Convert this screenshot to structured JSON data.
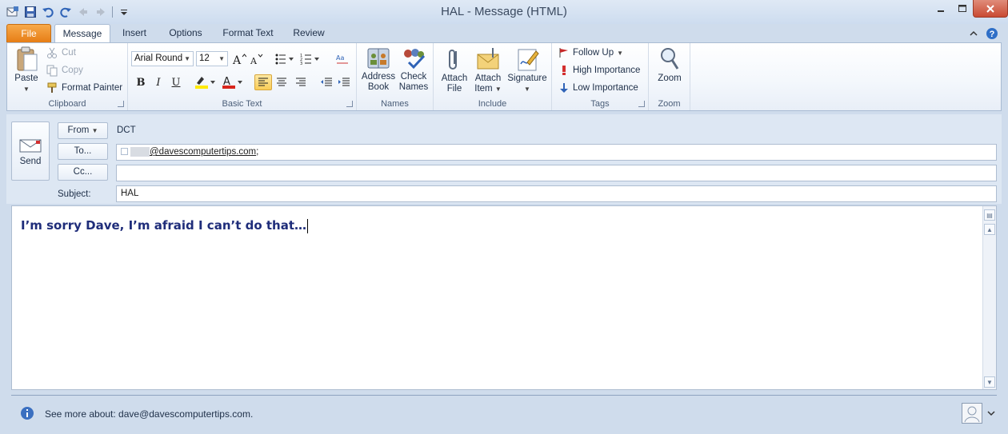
{
  "window": {
    "title": "HAL  -  Message (HTML)"
  },
  "ribbon_tabs": [
    {
      "label": "File"
    },
    {
      "label": "Message"
    },
    {
      "label": "Insert"
    },
    {
      "label": "Options"
    },
    {
      "label": "Format Text"
    },
    {
      "label": "Review"
    }
  ],
  "clipboard": {
    "paste": "Paste",
    "cut": "Cut",
    "copy": "Copy",
    "format_painter": "Format Painter",
    "label": "Clipboard"
  },
  "basic_text": {
    "font": "Arial Round",
    "size": "12",
    "bold": "B",
    "italic": "I",
    "underline": "U",
    "label": "Basic Text"
  },
  "names": {
    "address_line1": "Address",
    "address_line2": "Book",
    "check_line1": "Check",
    "check_line2": "Names",
    "label": "Names"
  },
  "include": {
    "attach_file_1": "Attach",
    "attach_file_2": "File",
    "attach_item_1": "Attach",
    "attach_item_2": "Item",
    "signature": "Signature",
    "label": "Include"
  },
  "tags": {
    "follow_up": "Follow Up",
    "high": "High Importance",
    "low": "Low Importance",
    "label": "Tags"
  },
  "zoom": {
    "button": "Zoom",
    "label": "Zoom"
  },
  "header": {
    "send": "Send",
    "from_button": "From",
    "from_value": "DCT",
    "to_button": "To...",
    "to_value": "@davescomputertips.com",
    "to_suffix": ";",
    "cc_button": "Cc...",
    "cc_value": "",
    "subject_label": "Subject:",
    "subject_value": "HAL"
  },
  "body": {
    "text": "I’m sorry Dave, I’m afraid I can’t do that…"
  },
  "people_pane": {
    "text": "See more about: dave@davescomputertips.com."
  },
  "colors": {
    "file_tab": "#e67d15",
    "body_text": "#1f2d7a",
    "close_button": "#c94a33"
  }
}
